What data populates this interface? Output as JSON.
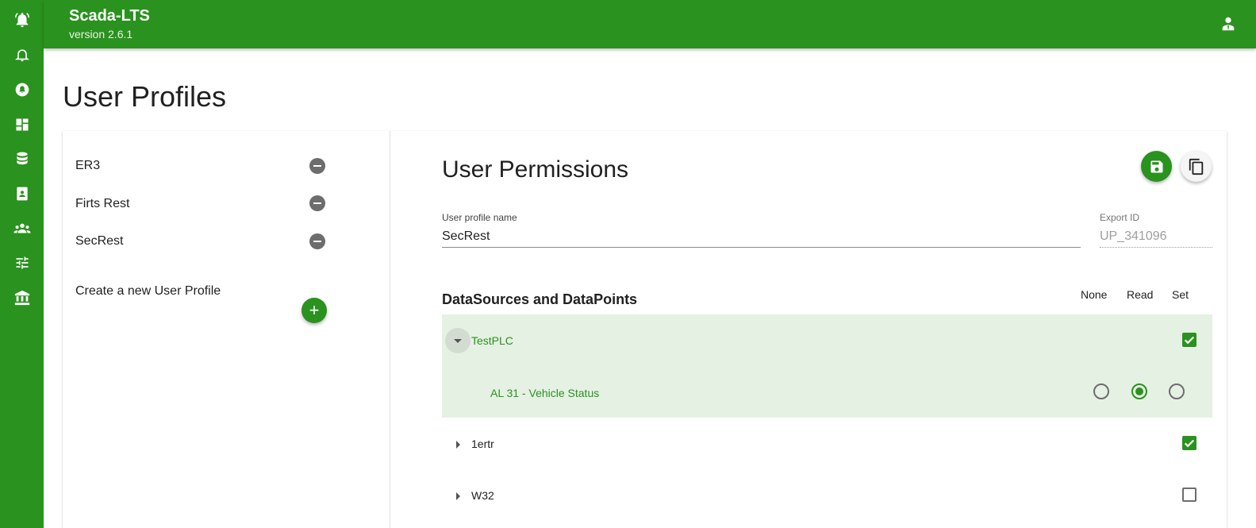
{
  "app": {
    "title": "Scada-LTS",
    "version": "version 2.6.1"
  },
  "sidebar": {
    "items": [
      {
        "icon": "alarm-bell-icon"
      },
      {
        "icon": "bell-icon"
      },
      {
        "icon": "alert-circle-icon"
      },
      {
        "icon": "dashboard-icon"
      },
      {
        "icon": "database-icon"
      },
      {
        "icon": "report-icon"
      },
      {
        "icon": "users-icon"
      },
      {
        "icon": "tune-icon"
      },
      {
        "icon": "institution-icon"
      }
    ]
  },
  "page": {
    "title": "User Profiles"
  },
  "profiles": {
    "items": [
      {
        "name": "ER3"
      },
      {
        "name": "Firts Rest"
      },
      {
        "name": "SecRest"
      }
    ],
    "create_label": "Create a new User Profile",
    "add_symbol": "+"
  },
  "permissions": {
    "title": "User Permissions",
    "name_label": "User profile name",
    "name_value": "SecRest",
    "export_label": "Export ID",
    "export_value": "UP_341096",
    "section_title": "DataSources and DataPoints",
    "columns": {
      "none": "None",
      "read": "Read",
      "set": "Set"
    },
    "datasources": [
      {
        "name": "TestPLC",
        "expanded": true,
        "set_checked": true,
        "points": [
          {
            "name": "AL 31 - Vehicle Status",
            "access": "read"
          }
        ]
      },
      {
        "name": "1ertr",
        "expanded": false,
        "set_checked": true
      },
      {
        "name": "W32",
        "expanded": false,
        "set_checked": false
      }
    ]
  },
  "colors": {
    "primary": "#2a921e",
    "highlight_row": "#e5f1e3",
    "text_green": "#2a921e"
  }
}
